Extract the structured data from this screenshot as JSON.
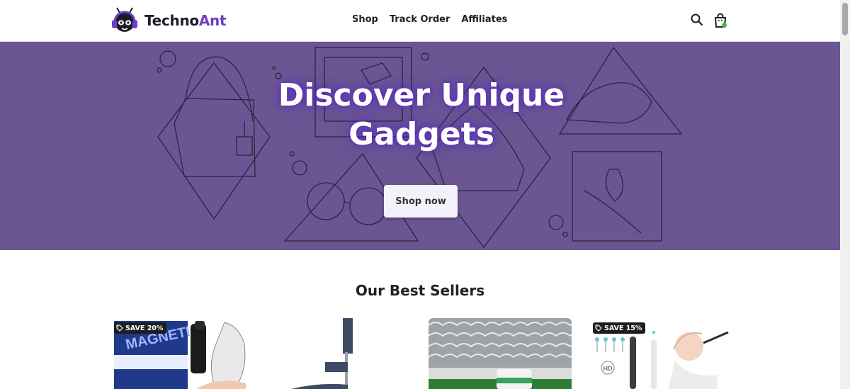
{
  "brand": {
    "name_part1": "Techno",
    "name_part2": "Ant",
    "accent_color": "#6d3fc7",
    "logo_icon": "ant-headphones-logo"
  },
  "nav": {
    "items": [
      {
        "label": "Shop"
      },
      {
        "label": "Track Order"
      },
      {
        "label": "Affiliates"
      }
    ]
  },
  "header_icons": {
    "search": "search-icon",
    "cart": "shopping-bag-icon",
    "cart_indicator_color": "#36c22c"
  },
  "hero": {
    "title": "Discover Unique Gadgets",
    "button_label": "Shop now",
    "background_color": "#6b5693"
  },
  "best_sellers": {
    "title": "Our Best Sellers",
    "products": [
      {
        "badge": "SAVE 20%",
        "box_text": "MAGNETIC"
      },
      {
        "badge": ""
      },
      {
        "badge": ""
      },
      {
        "badge": "SAVE 15%",
        "hd_label": "HD"
      }
    ]
  }
}
